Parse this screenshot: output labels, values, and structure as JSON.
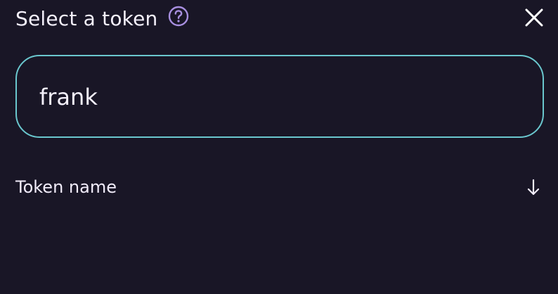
{
  "header": {
    "title": "Select a token",
    "help_icon": "question-circle-icon",
    "close_icon": "close-icon"
  },
  "search": {
    "value": "frank",
    "placeholder": ""
  },
  "list": {
    "column_label": "Token name",
    "sort_icon": "arrow-down-icon"
  },
  "colors": {
    "background": "#191626",
    "input_border": "#6ac7ce",
    "help_icon": "#a88fe0",
    "text": "#f1ecfa"
  }
}
